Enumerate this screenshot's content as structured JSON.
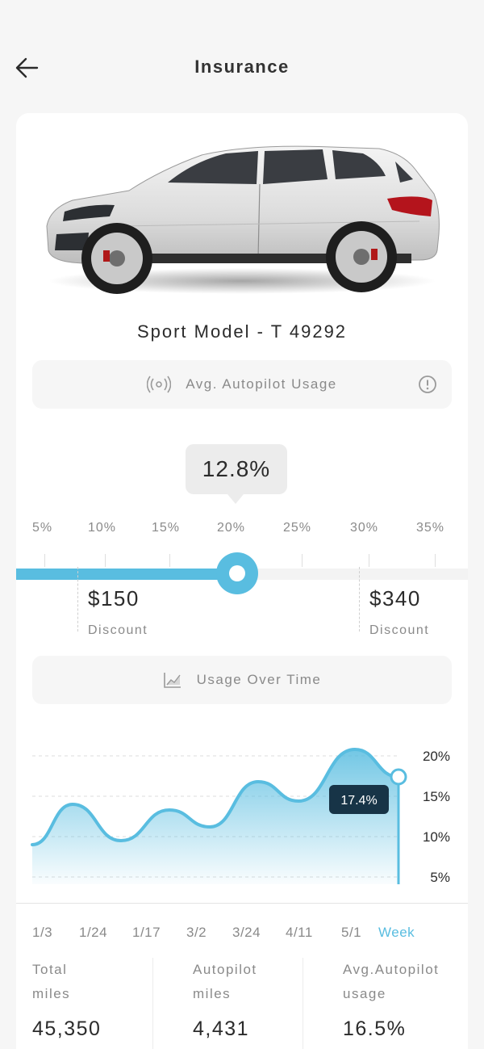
{
  "header": {
    "title": "Insurance"
  },
  "vehicle": {
    "model": "Sport Model - T 49292"
  },
  "autopilot_pill": {
    "label": "Avg. Autopilot Usage",
    "icon": "radar-icon"
  },
  "slider": {
    "current_value_label": "12.8%",
    "scale_labels": [
      "5%",
      "10%",
      "15%",
      "20%",
      "25%",
      "30%",
      "35%"
    ],
    "fill_percent": 48.6
  },
  "discounts": [
    {
      "amount": "$150",
      "label": "Discount"
    },
    {
      "amount": "$340",
      "label": "Discount"
    }
  ],
  "usage_pill": {
    "label": "Usage Over Time",
    "icon": "chart-icon"
  },
  "chart_data": {
    "type": "area",
    "x": [
      "1/3",
      "1/24",
      "1/17",
      "3/2",
      "3/24",
      "4/11",
      "5/1",
      "Week"
    ],
    "y_ticks": [
      "20%",
      "15%",
      "10%",
      "5%"
    ],
    "ylim": [
      5,
      21
    ],
    "series": [
      {
        "values": [
          9.0,
          14.0,
          9.5,
          13.3,
          11.2,
          16.8,
          14.4,
          20.8,
          17.4
        ]
      }
    ],
    "highlight_label": "17.4%",
    "color": "#59bde0",
    "grid": true
  },
  "stats": [
    {
      "label_line1": "Total",
      "label_line2": "miles",
      "value": "45,350"
    },
    {
      "label_line1": "Autopilot",
      "label_line2": "miles",
      "value": "4,431"
    },
    {
      "label_line1": "Avg.Autopilot",
      "label_line2": "usage",
      "value": "16.5%"
    }
  ]
}
